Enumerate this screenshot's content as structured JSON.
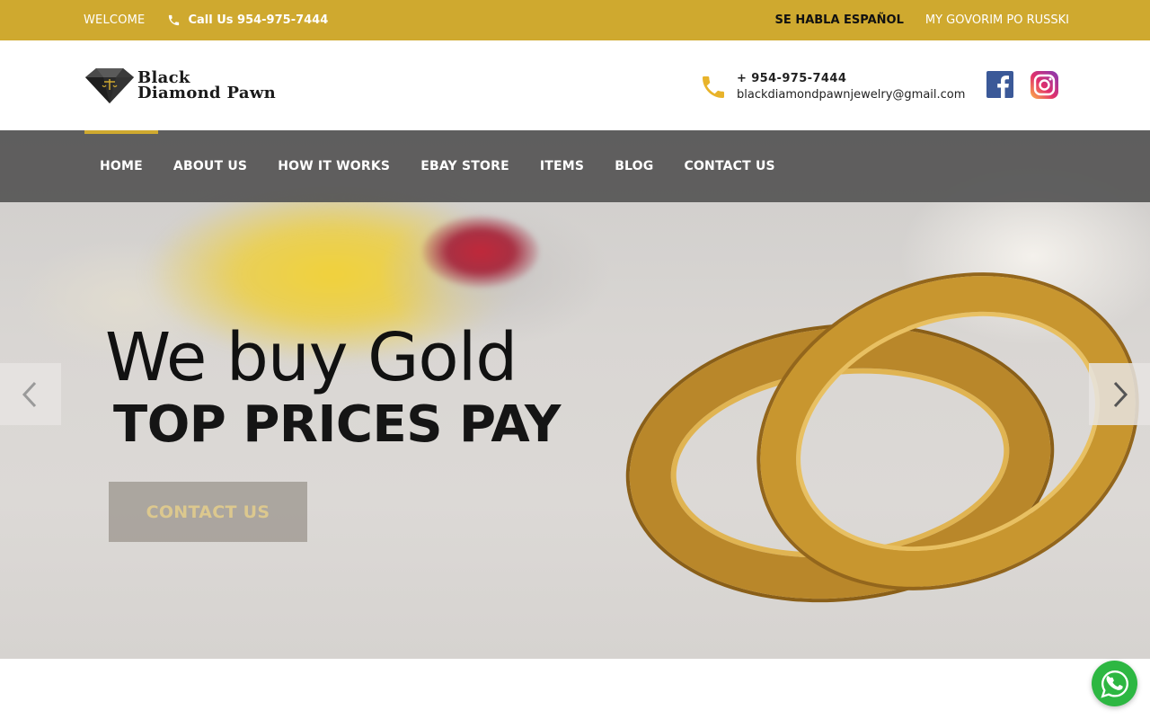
{
  "topbar": {
    "welcome": "WELCOME",
    "call": "Call Us 954-975-7444",
    "lang_es": "SE HABLA ESPAÑOL",
    "lang_ru": "MY GOVORIM PO RUSSKI"
  },
  "header": {
    "logo_line1": "Black",
    "logo_line2": "Diamond Pawn",
    "phone": "+ 954-975-7444",
    "email": "blackdiamondpawnjewelry@gmail.com"
  },
  "nav": {
    "items": [
      {
        "label": "HOME",
        "active": true
      },
      {
        "label": "ABOUT US"
      },
      {
        "label": "HOW IT WORKS"
      },
      {
        "label": "EBAY STORE"
      },
      {
        "label": "ITEMS"
      },
      {
        "label": "BLOG"
      },
      {
        "label": "CONTACT US"
      }
    ]
  },
  "hero": {
    "headline": "We buy Gold",
    "subline": "TOP PRICES PAY",
    "cta": "CONTACT US"
  },
  "colors": {
    "brand_gold": "#cfa92f",
    "nav_bg": "#555555",
    "whatsapp": "#2db742"
  },
  "icons": [
    "phone-icon",
    "facebook-icon",
    "instagram-icon",
    "chevron-left-icon",
    "chevron-right-icon",
    "whatsapp-icon"
  ]
}
